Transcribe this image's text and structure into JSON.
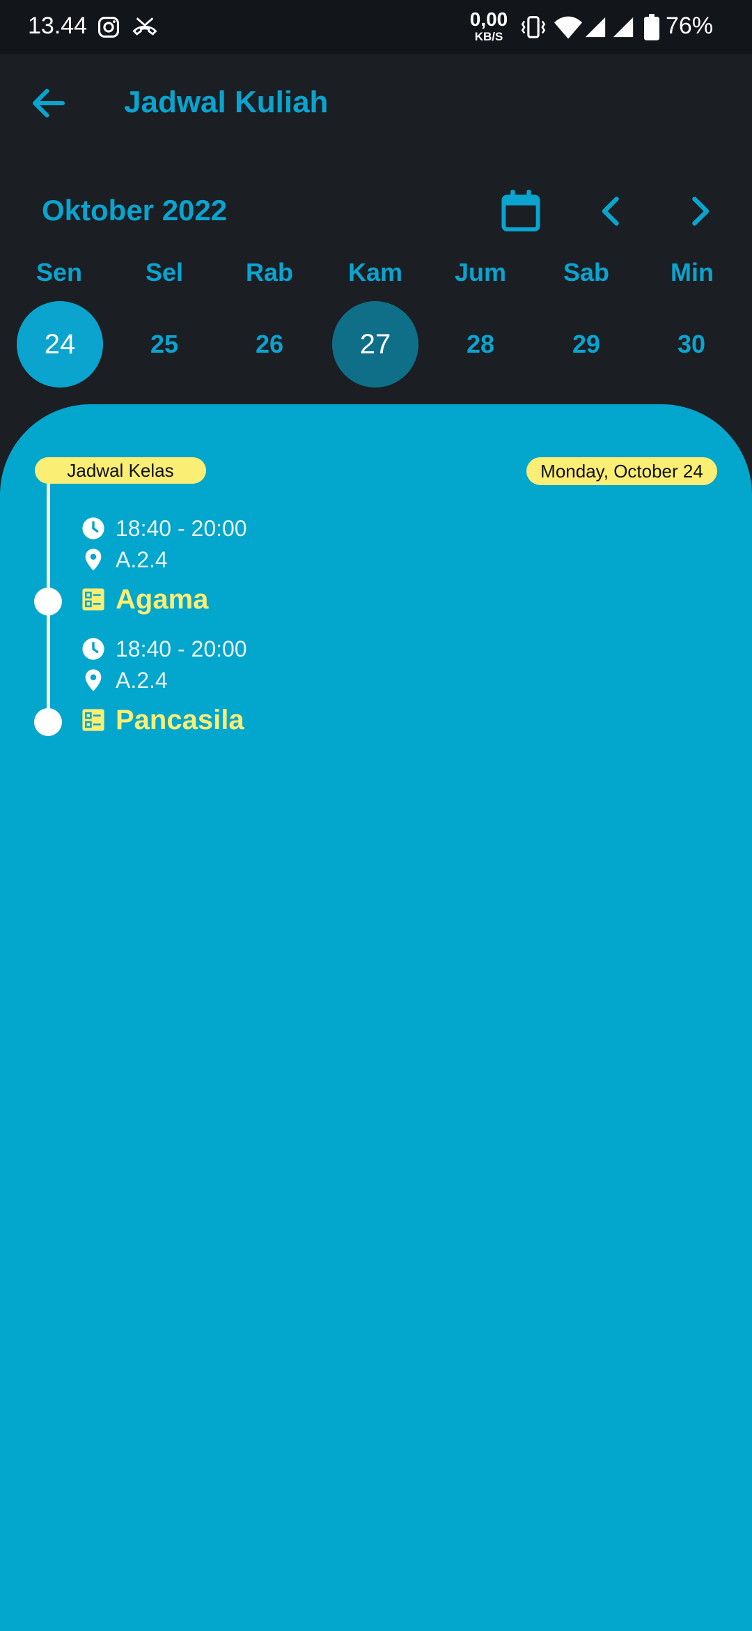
{
  "status_bar": {
    "time": "13.44",
    "net_speed_value": "0,00",
    "net_speed_unit": "KB/S",
    "battery_pct": "76%"
  },
  "app_bar": {
    "title": "Jadwal Kuliah"
  },
  "calendar": {
    "month_label": "Oktober 2022",
    "weekdays": [
      "Sen",
      "Sel",
      "Rab",
      "Kam",
      "Jum",
      "Sab",
      "Min"
    ],
    "dates": [
      "24",
      "25",
      "26",
      "27",
      "28",
      "29",
      "30"
    ],
    "selected_date": "24",
    "today_date": "27"
  },
  "schedule": {
    "chip_label": "Jadwal Kelas",
    "date_label": "Monday, October 24",
    "items": [
      {
        "time": "18:40 - 20:00",
        "room": "A.2.4",
        "course": "Agama"
      },
      {
        "time": "18:40 - 20:00",
        "room": "A.2.4",
        "course": "Pancasila"
      }
    ]
  },
  "colors": {
    "background": "#1b1f24",
    "accent": "#0aa4cf",
    "panel": "#03a6cc",
    "today_circle": "#0f6f89",
    "highlight_yellow": "#fbee74"
  },
  "icons": {
    "back": "arrow-left-icon",
    "calendar": "calendar-icon",
    "prev": "chevron-left-icon",
    "next": "chevron-right-icon",
    "time": "clock-icon",
    "room": "location-pin-icon",
    "course": "list-icon"
  }
}
